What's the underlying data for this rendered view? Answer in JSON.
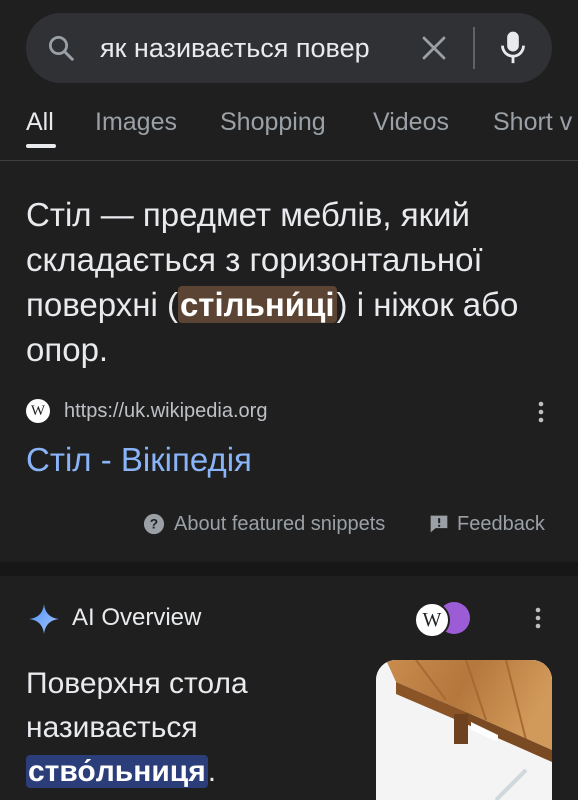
{
  "search": {
    "query": "як називається повер",
    "icon": "search-icon",
    "clear_icon": "close-icon",
    "voice_icon": "mic-icon"
  },
  "tabs": [
    {
      "label": "All",
      "active": true
    },
    {
      "label": "Images",
      "active": false
    },
    {
      "label": "Shopping",
      "active": false
    },
    {
      "label": "Videos",
      "active": false
    },
    {
      "label": "Short v",
      "active": false
    }
  ],
  "featured_snippet": {
    "text_before": "Стіл — предмет меблів, який складається з горизонтальної поверхні (",
    "highlight": "стільни́ці",
    "text_after": ") і ніжок або опор.",
    "source_url": "https://uk.wikipedia.org",
    "favicon_letter": "W",
    "title": "Стіл - Вікіпедія",
    "about_label": "About featured snippets",
    "feedback_label": "Feedback"
  },
  "ai_overview": {
    "title": "AI Overview",
    "text_before": "Поверхня стола називається ",
    "highlight": "ство́льниця",
    "text_after": ".",
    "source_letter": "W"
  },
  "colors": {
    "background": "#1f1f1f",
    "link": "#8ab4f8",
    "snippet_highlight": "#5b4433",
    "ai_highlight": "#2c3e7a"
  }
}
